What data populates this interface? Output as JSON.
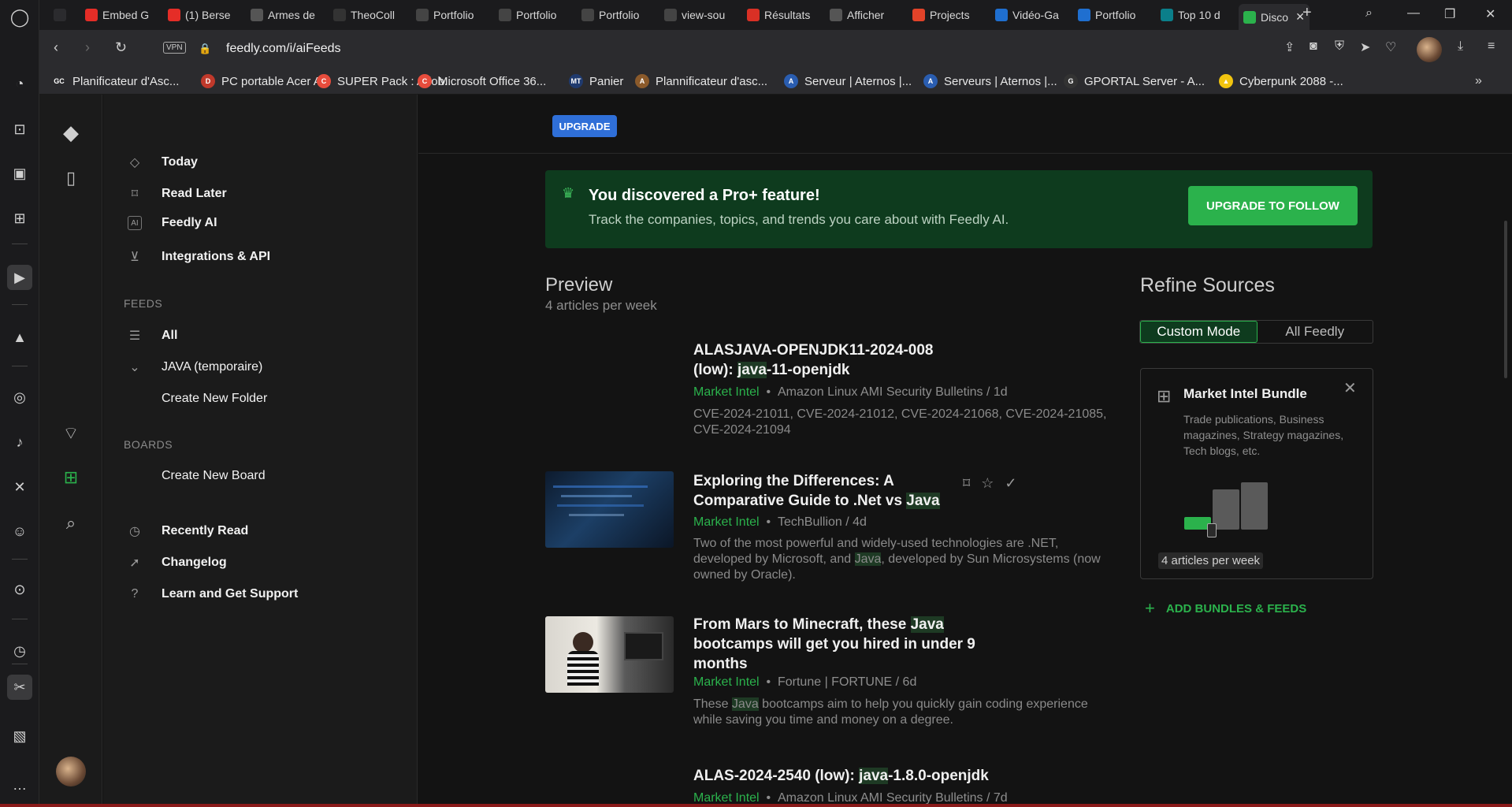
{
  "browser": {
    "tabs": [
      {
        "label": "",
        "icon": "gamepad-icon",
        "color": "#2b2b2e"
      },
      {
        "label": "Embed G",
        "icon": "youtube-icon",
        "color": "#e52d27"
      },
      {
        "label": "(1) Berse",
        "icon": "youtube-icon",
        "color": "#e52d27"
      },
      {
        "label": "Armes de",
        "icon": "diamond-icon",
        "color": "#555555"
      },
      {
        "label": "TheoColl",
        "icon": "github-icon",
        "color": "#333333"
      },
      {
        "label": "Portfolio",
        "icon": "globe-icon",
        "color": "#444444"
      },
      {
        "label": "Portfolio",
        "icon": "globe-icon",
        "color": "#444444"
      },
      {
        "label": "Portfolio",
        "icon": "globe-icon",
        "color": "#444444"
      },
      {
        "label": "view-sou",
        "icon": "globe-icon",
        "color": "#444444"
      },
      {
        "label": "Résultats",
        "icon": "gmail-icon",
        "color": "#d93025"
      },
      {
        "label": "Afficher",
        "icon": "chatgpt-icon",
        "color": "#555555"
      },
      {
        "label": "Projects",
        "icon": "gitlab-icon",
        "color": "#e24329"
      },
      {
        "label": "Vidéo-Ga",
        "icon": "trello-icon",
        "color": "#1f6fd0"
      },
      {
        "label": "Portfolio",
        "icon": "trello-icon",
        "color": "#1f6fd0"
      },
      {
        "label": "Top 10 d",
        "icon": "k-icon",
        "color": "#0b7f8a"
      },
      {
        "label": "Disco",
        "icon": "feedly-icon",
        "color": "#2bb24c"
      }
    ],
    "url": "feedly.com/i/aiFeeds",
    "vpn_label": "VPN",
    "bookmarks": [
      {
        "label": "Planificateur d'Asc...",
        "icon_text": "GC",
        "color": "#2b2b2e"
      },
      {
        "label": "PC portable Acer A...",
        "icon_text": "D",
        "color": "#c0392b"
      },
      {
        "label": "SUPER Pack : Adob...",
        "icon_text": "C",
        "color": "#e74c3c"
      },
      {
        "label": "Microsoft Office 36...",
        "icon_text": "C",
        "color": "#e74c3c"
      },
      {
        "label": "Panier",
        "icon_text": "MT",
        "color": "#1f3a6e"
      },
      {
        "label": "Plannificateur d'asc...",
        "icon_text": "A",
        "color": "#8b5a2b"
      },
      {
        "label": "Serveur | Aternos |...",
        "icon_text": "A",
        "color": "#2a5db0"
      },
      {
        "label": "Serveurs | Aternos |...",
        "icon_text": "A",
        "color": "#2a5db0"
      },
      {
        "label": "GPORTAL Server - A...",
        "icon_text": "G",
        "color": "#333333"
      },
      {
        "label": "Cyberpunk 2088 -...",
        "icon_text": "▲",
        "color": "#f1c40f"
      }
    ]
  },
  "nav": {
    "today": "Today",
    "read_later": "Read Later",
    "feedly_ai": "Feedly AI",
    "integrations": "Integrations & API",
    "feeds_title": "FEEDS",
    "all": "All",
    "java_folder": "JAVA (temporaire)",
    "create_folder": "Create New Folder",
    "boards_title": "BOARDS",
    "create_board": "Create New Board",
    "recently_read": "Recently Read",
    "changelog": "Changelog",
    "learn": "Learn and Get Support"
  },
  "main": {
    "upgrade": "UPGRADE",
    "promo": {
      "title": "You discovered a Pro+ feature!",
      "subtitle": "Track the companies, topics, and trends you care about with Feedly AI.",
      "button": "UPGRADE TO FOLLOW"
    },
    "preview_title": "Preview",
    "preview_sub": "4 articles per week",
    "articles": [
      {
        "title_a": "ALASJAVA-OPENJDK11-2024-008 (low): ",
        "title_hl": "java",
        "title_b": "-11-openjdk",
        "source": "Market Intel",
        "meta": "Amazon Linux AMI Security Bulletins / 1d",
        "summary": "CVE-2024-21011, CVE-2024-21012, CVE-2024-21068, CVE-2024-21085, CVE-2024-21094"
      },
      {
        "title_a": "Exploring the Differences: A Comparative Guide to .Net vs ",
        "title_hl": "Java",
        "title_b": "",
        "source": "Market Intel",
        "meta": "TechBullion / 4d",
        "summary_a": "Two of the most powerful and widely-used technologies are .NET, developed by Microsoft, and ",
        "summary_hl": "Java",
        "summary_b": ", developed by Sun Microsystems (now owned by Oracle)."
      },
      {
        "title_a": "From Mars to Minecraft, these ",
        "title_hl": "Java",
        "title_b": " bootcamps will get you hired in under 9 months",
        "source": "Market Intel",
        "meta": "Fortune | FORTUNE / 6d",
        "summary_a": "These ",
        "summary_hl": "Java",
        "summary_b": " bootcamps aim to help you quickly gain coding experience while saving you time and money on a degree."
      },
      {
        "title_a": "ALAS-2024-2540 (low): ",
        "title_hl": "java",
        "title_b": "-1.8.0-openjdk",
        "source": "Market Intel",
        "meta": "Amazon Linux AMI Security Bulletins / 7d"
      }
    ],
    "meta_sep": "•",
    "refine": {
      "title": "Refine Sources",
      "mode_custom": "Custom Mode",
      "mode_all": "All Feedly",
      "bundle_title": "Market Intel Bundle",
      "bundle_desc": "Trade publications, Business magazines, Strategy magazines, Tech blogs, etc.",
      "bundle_volume": "4 articles per week",
      "add": "ADD BUNDLES & FEEDS"
    }
  },
  "colors": {
    "accent": "#2bb24c",
    "upgrade_blue": "#2f6fd8",
    "promo_bg": "#0e3b1e"
  }
}
